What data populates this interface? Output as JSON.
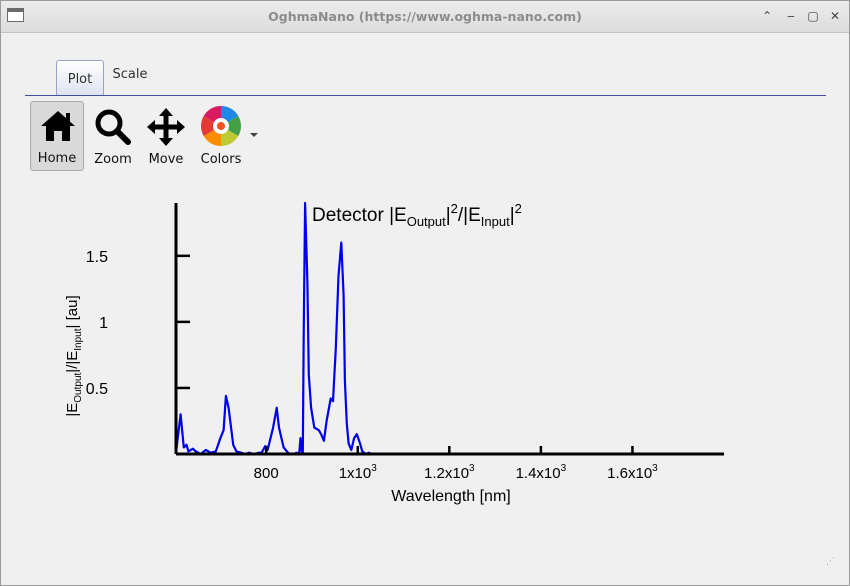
{
  "window": {
    "title": "OghmaNano (https://www.oghma-nano.com)"
  },
  "tabs": [
    {
      "label": "Plot"
    },
    {
      "label": "Scale"
    }
  ],
  "toolbar": {
    "home_label": "Home",
    "zoom_label": "Zoom",
    "move_label": "Move",
    "colors_label": "Colors"
  },
  "colors": {
    "line": "#0000ee",
    "accent": "#3e4ea0"
  },
  "chart_data": {
    "type": "line",
    "title_main": "Detector |E",
    "title_sub1": "Output",
    "title_mid": "|",
    "title_sup1": "2",
    "title_slash": "/|E",
    "title_sub2": "Input",
    "title_end": "|",
    "title_sup2": "2",
    "xlabel": "Wavelength [nm]",
    "ylabel_parts": [
      "|E",
      "Output",
      "|/|E",
      "Input",
      "| [au]"
    ],
    "xlim": [
      603,
      1800
    ],
    "ylim": [
      0,
      1.9
    ],
    "xticks": [
      {
        "v": 800,
        "label": "800"
      },
      {
        "v": 1000,
        "label": "1x10",
        "exp": "3"
      },
      {
        "v": 1200,
        "label": "1.2x10",
        "exp": "3"
      },
      {
        "v": 1400,
        "label": "1.4x10",
        "exp": "3"
      },
      {
        "v": 1600,
        "label": "1.6x10",
        "exp": "3"
      }
    ],
    "yticks": [
      {
        "v": 0.5,
        "label": "0.5"
      },
      {
        "v": 1,
        "label": "1"
      },
      {
        "v": 1.5,
        "label": "1.5"
      }
    ],
    "series": [
      {
        "x": [
          603,
          606,
          613,
          620,
          626,
          630,
          640,
          646,
          657,
          668,
          679,
          690,
          700,
          707,
          712,
          718,
          728,
          735,
          745,
          754,
          763,
          773,
          784,
          790,
          798,
          803,
          815,
          823,
          828,
          838,
          850,
          855,
          862,
          866,
          872,
          875,
          878,
          880,
          882,
          885,
          890,
          893,
          898,
          905,
          915,
          920,
          926,
          932,
          941,
          946,
          952,
          958,
          964,
          969,
          972,
          976,
          980,
          986,
          992,
          998,
          1005,
          1010,
          1018,
          1024,
          1030,
          1040,
          1050,
          1070,
          1100,
          1130,
          1160,
          1180,
          1200,
          1220,
          1235,
          1245,
          1260,
          1280,
          1295,
          1310,
          1320,
          1330,
          1350,
          1370,
          1385,
          1400,
          1410,
          1420,
          1430,
          1440,
          1450,
          1460,
          1470,
          1480,
          1490,
          1500,
          1510,
          1520,
          1530,
          1540,
          1560,
          1600,
          1650,
          1700,
          1750,
          1800
        ],
        "y": [
          0.0,
          0.1,
          0.3,
          0.05,
          0.07,
          0.02,
          0.04,
          0.02,
          0.0,
          0.03,
          0.01,
          0.02,
          0.12,
          0.18,
          0.44,
          0.35,
          0.07,
          0.02,
          0.01,
          0.0,
          0.01,
          0.0,
          0.01,
          0.01,
          0.06,
          0.03,
          0.2,
          0.35,
          0.2,
          0.05,
          0.0,
          0.0,
          0.0,
          0.01,
          0.0,
          0.12,
          0.02,
          0.0,
          0.9,
          1.9,
          1.3,
          0.6,
          0.35,
          0.2,
          0.18,
          0.15,
          0.1,
          0.25,
          0.42,
          0.4,
          0.8,
          1.35,
          1.6,
          1.2,
          0.55,
          0.23,
          0.08,
          0.03,
          0.12,
          0.15,
          0.08,
          0.02,
          0.0,
          0.01,
          0.0,
          0.0,
          0.0,
          0.0,
          0.0,
          0.0,
          0.0,
          0.0,
          0.0,
          0.0,
          0.0,
          0.0,
          0.0,
          0.0,
          0.0,
          0.0,
          0.0,
          0.0,
          0.0,
          0.0,
          0.0,
          0.0,
          0.0,
          0.0,
          0.0,
          0.0,
          0.0,
          0.0,
          0.0,
          0.0,
          0.0,
          0.0,
          0.0,
          0.0,
          0.0,
          0.0,
          0.0,
          0.0,
          0.0,
          0.0,
          0.0,
          0.0
        ]
      }
    ]
  }
}
